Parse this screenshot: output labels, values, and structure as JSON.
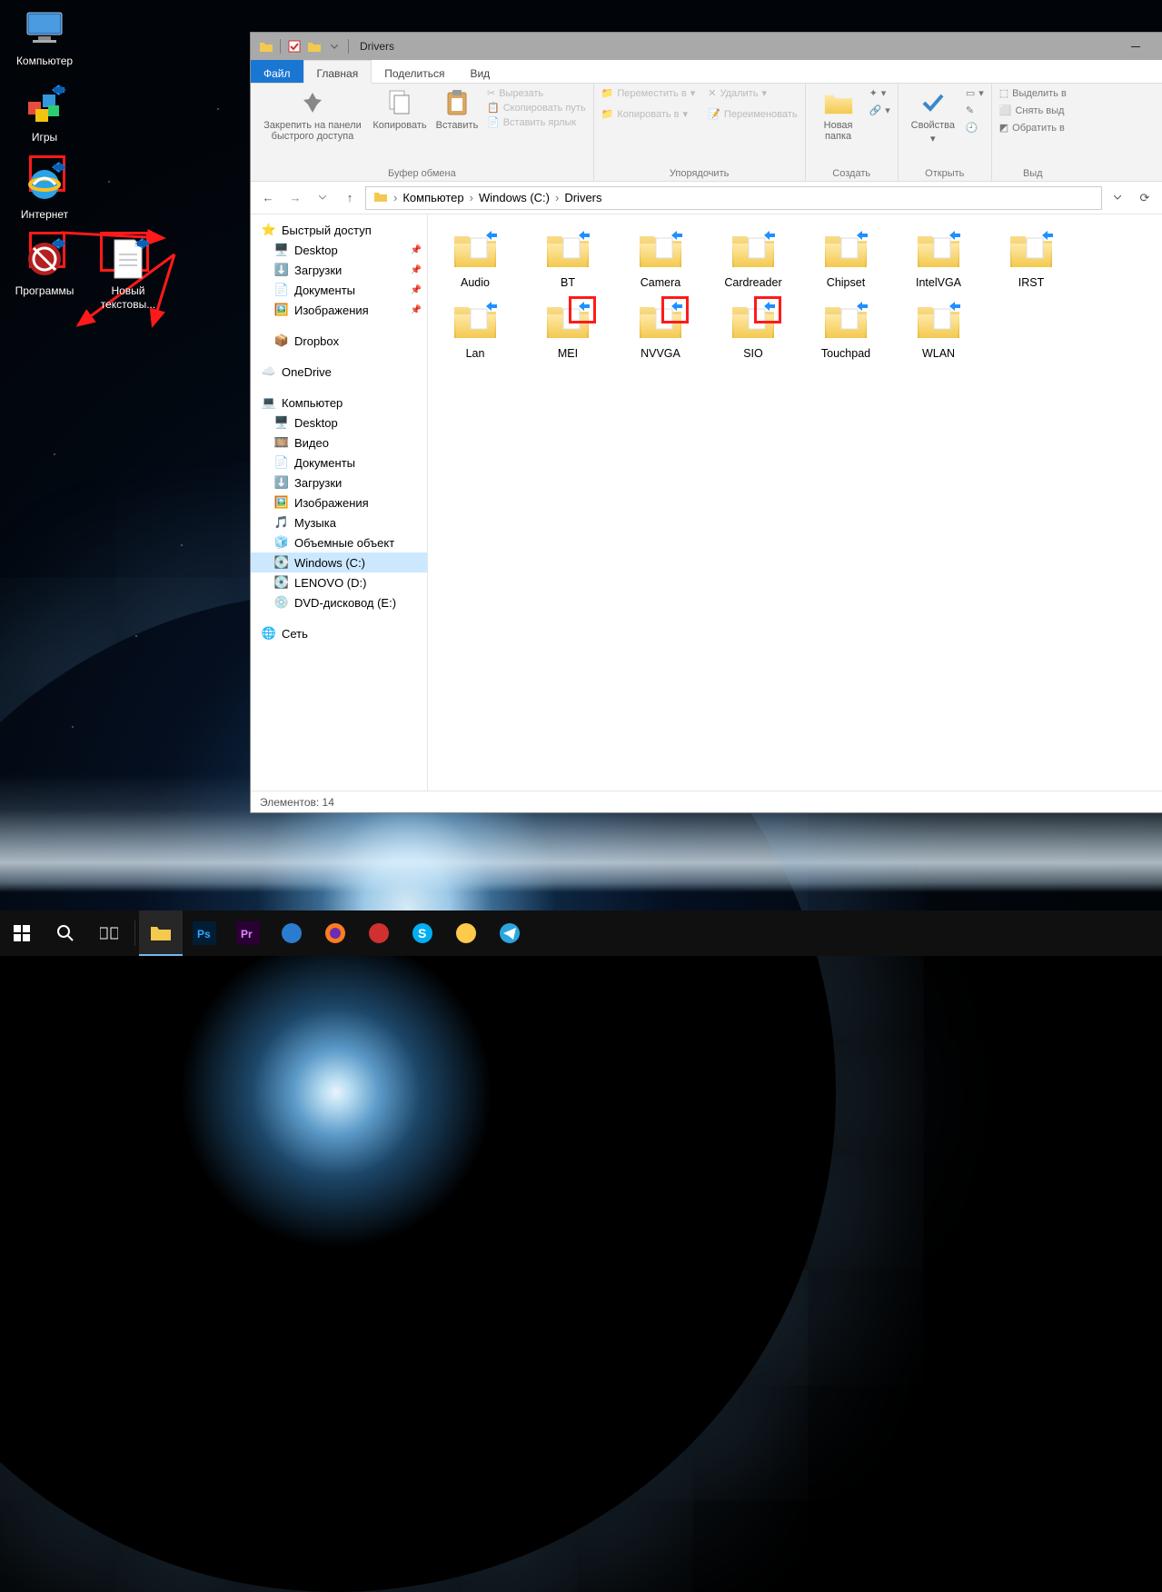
{
  "desktop_icons": {
    "computer": "Компьютер",
    "games": "Игры",
    "internet": "Интернет",
    "programs": "Программы",
    "new_text": "Новый текстовы..."
  },
  "window": {
    "title": "Drivers",
    "tabs": {
      "file": "Файл",
      "home": "Главная",
      "share": "Поделиться",
      "view": "Вид"
    },
    "ribbon": {
      "pin": "Закрепить на панели быстрого доступа",
      "copy": "Копировать",
      "paste": "Вставить",
      "cut": "Вырезать",
      "copy_path": "Скопировать путь",
      "paste_shortcut": "Вставить ярлык",
      "clipboard_group": "Буфер обмена",
      "move_to": "Переместить в",
      "copy_to": "Копировать в",
      "delete": "Удалить",
      "rename": "Переименовать",
      "organize_group": "Упорядочить",
      "new_folder": "Новая папка",
      "create_group": "Создать",
      "properties": "Свойства",
      "open_group": "Открыть",
      "select_all": "Выделить в",
      "select_none": "Снять выд",
      "invert_sel": "Обратить в",
      "select_group": "Выд"
    },
    "breadcrumb": [
      "Компьютер",
      "Windows (C:)",
      "Drivers"
    ],
    "sidebar": {
      "quick_access": "Быстрый доступ",
      "desktop": "Desktop",
      "downloads": "Загрузки",
      "documents": "Документы",
      "pictures": "Изображения",
      "dropbox": "Dropbox",
      "onedrive": "OneDrive",
      "computer": "Компьютер",
      "c_desktop": "Desktop",
      "c_videos": "Видео",
      "c_documents": "Документы",
      "c_downloads": "Загрузки",
      "c_pictures": "Изображения",
      "c_music": "Музыка",
      "c_3d": "Объемные объект",
      "c_windows": "Windows (C:)",
      "c_lenovo": "LENOVO (D:)",
      "c_dvd": "DVD-дисковод (E:)",
      "network": "Сеть"
    },
    "folders": [
      "Audio",
      "BT",
      "Camera",
      "Cardreader",
      "Chipset",
      "IntelVGA",
      "IRST",
      "Lan",
      "MEI",
      "NVVGA",
      "SIO",
      "Touchpad",
      "WLAN"
    ],
    "status": "Элементов: 14"
  }
}
